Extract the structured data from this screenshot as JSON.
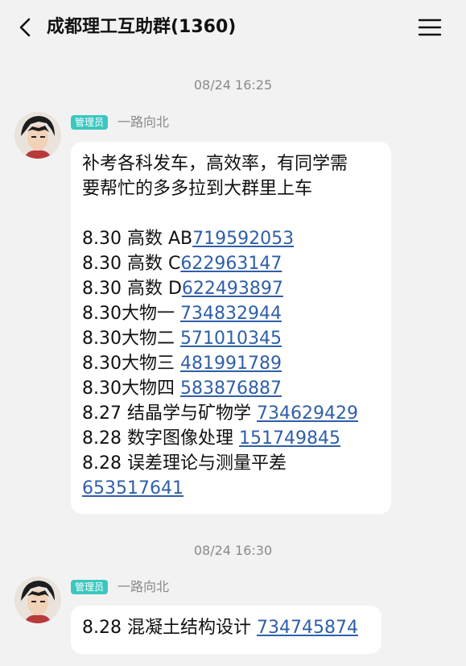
{
  "header": {
    "title": "成都理工互助群(1360)"
  },
  "messages": [
    {
      "time": "08/24 16:25",
      "role": "管理员",
      "sender": "一路向北",
      "intro": [
        "补考各科发车，高效率，有同学需",
        "要帮忙的多多拉到大群里上车"
      ],
      "lines": [
        {
          "text": "8.30 高数 AB",
          "link": "719592053"
        },
        {
          "text": "8.30 高数 C",
          "link": "622963147"
        },
        {
          "text": "8.30 高数 D",
          "link": "622493897"
        },
        {
          "text": "8.30大物一 ",
          "link": "734832944"
        },
        {
          "text": "8.30大物二 ",
          "link": "571010345"
        },
        {
          "text": "8.30大物三 ",
          "link": "481991789"
        },
        {
          "text": "8.30大物四 ",
          "link": "583876887"
        },
        {
          "text": "8.27 结晶学与矿物学 ",
          "link": "734629429"
        },
        {
          "text": "8.28 数字图像处理 ",
          "link": "151749845"
        },
        {
          "text": "8.28 误差理论与测量平差",
          "link": ""
        },
        {
          "text": " ",
          "link": "653517641"
        }
      ]
    },
    {
      "time": "08/24 16:30",
      "role": "管理员",
      "sender": "一路向北",
      "lines": [
        {
          "text": "8.28 混凝土结构设计 ",
          "link": "734745874"
        }
      ]
    }
  ]
}
